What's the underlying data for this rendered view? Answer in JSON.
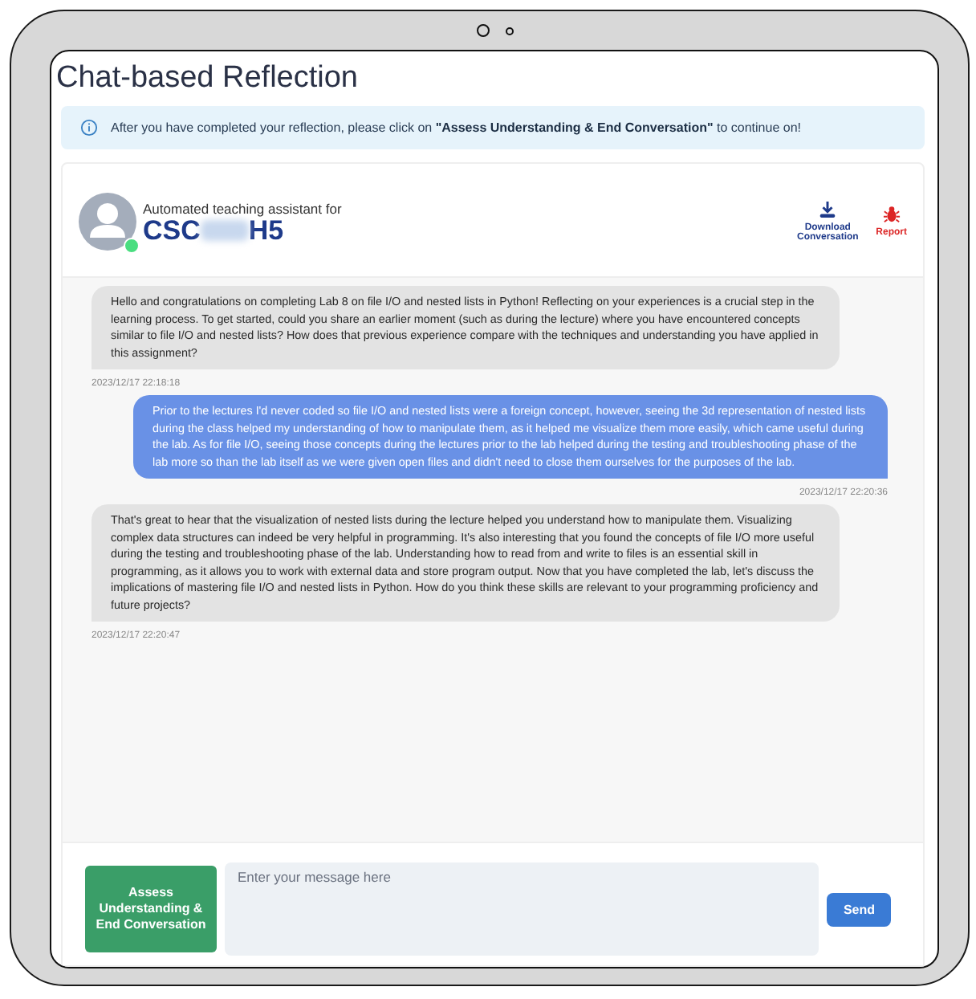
{
  "page": {
    "title": "Chat-based Reflection"
  },
  "notice": {
    "before": "After you have completed your reflection, please click on ",
    "highlight": "\"Assess Understanding & End Conversation\"",
    "after": " to continue on!"
  },
  "assistant": {
    "online": true,
    "caption": "Automated teaching assistant for",
    "course_prefix": "CSC",
    "course_suffix": "H5"
  },
  "actions": [
    {
      "kind": "download",
      "label": "Download Conversation"
    },
    {
      "kind": "report",
      "label": "Report"
    }
  ],
  "messages": [
    {
      "kind": "assistant",
      "text": "Hello and congratulations on completing Lab 8 on file I/O and nested lists in Python! Reflecting on your experiences is a crucial step in the learning process. To get started, could you share an earlier moment (such as during the lecture) where you have encountered concepts similar to file I/O and nested lists? How does that previous experience compare with the techniques and understanding you have applied in this assignment?",
      "time": "2023/12/17 22:18:18"
    },
    {
      "kind": "user",
      "text": "Prior to the lectures I'd never coded so file I/O and nested lists were a foreign concept, however, seeing the 3d representation of nested lists during the class helped my understanding of how to manipulate them, as it helped me visualize them more easily, which came useful during the lab. As for file I/O, seeing those concepts during the lectures prior to the lab helped during the testing and troubleshooting phase of the lab more so than the lab itself as we were given open files and didn't need to close them ourselves for the purposes of the lab.",
      "time": "2023/12/17 22:20:36"
    },
    {
      "kind": "assistant",
      "text": "That's great to hear that the visualization of nested lists during the lecture helped you understand how to manipulate them. Visualizing complex data structures can indeed be very helpful in programming. It's also interesting that you found the concepts of file I/O more useful during the testing and troubleshooting phase of the lab. Understanding how to read from and write to files is an essential skill in programming, as it allows you to work with external data and store program output. Now that you have completed the lab, let's discuss the implications of mastering file I/O and nested lists in Python. How do you think these skills are relevant to your programming proficiency and future projects?",
      "time": "2023/12/17 22:20:47"
    }
  ],
  "composer": {
    "end_button": "Assess Understanding & End Conversation",
    "placeholder": "Enter your message here",
    "send_button": "Send"
  }
}
